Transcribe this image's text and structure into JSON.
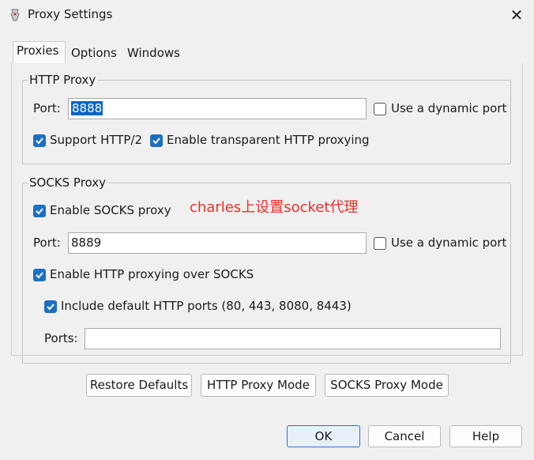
{
  "window": {
    "title": "Proxy Settings",
    "close_glyph": "✕"
  },
  "tabs": [
    {
      "label": "Proxies",
      "active": true
    },
    {
      "label": "Options",
      "active": false
    },
    {
      "label": "Windows",
      "active": false
    }
  ],
  "http_proxy": {
    "legend": "HTTP Proxy",
    "port_label": "Port:",
    "port_value": "8888",
    "dynamic_port_label": "Use a dynamic port",
    "dynamic_port_checked": false,
    "http2_label": "Support HTTP/2",
    "http2_checked": true,
    "transparent_label": "Enable transparent HTTP proxying",
    "transparent_checked": true
  },
  "socks_proxy": {
    "legend": "SOCKS Proxy",
    "enable_label": "Enable SOCKS proxy",
    "enable_checked": true,
    "annotation": "charles上设置socket代理",
    "port_label": "Port:",
    "port_value": "8889",
    "dynamic_port_label": "Use a dynamic port",
    "dynamic_port_checked": false,
    "http_over_socks_label": "Enable HTTP proxying over SOCKS",
    "http_over_socks_checked": true,
    "default_ports_label": "Include default HTTP ports (80, 443, 8080, 8443)",
    "default_ports_checked": true,
    "ports_label": "Ports:",
    "ports_value": ""
  },
  "mode_buttons": {
    "restore": "Restore Defaults",
    "http_mode": "HTTP Proxy Mode",
    "socks_mode": "SOCKS Proxy Mode"
  },
  "dialog_buttons": {
    "ok": "OK",
    "cancel": "Cancel",
    "help": "Help"
  },
  "colors": {
    "accent": "#1d6fc2",
    "annotation": "#e8302a",
    "selection": "#0a64c8"
  }
}
